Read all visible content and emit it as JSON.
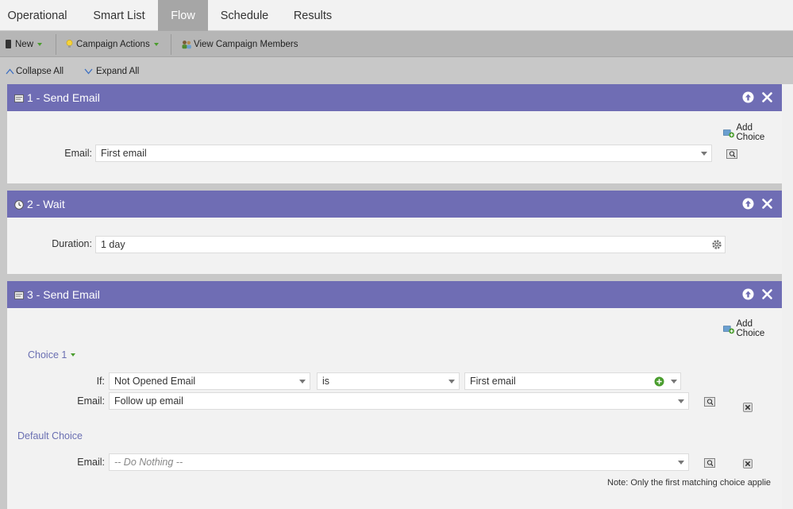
{
  "tabs": [
    {
      "label": "Operational",
      "active": false
    },
    {
      "label": "Smart List",
      "active": false
    },
    {
      "label": "Flow",
      "active": true
    },
    {
      "label": "Schedule",
      "active": false
    },
    {
      "label": "Results",
      "active": false
    }
  ],
  "toolbar": {
    "new_label": "New",
    "campaign_actions_label": "Campaign Actions",
    "view_members_label": "View Campaign Members"
  },
  "subbar": {
    "collapse_label": "Collapse All",
    "expand_label": "Expand All"
  },
  "steps": [
    {
      "title": "1 - Send Email",
      "icon": "email-icon",
      "add_choice": "Add Choice",
      "email_label": "Email:",
      "email_value": "First email"
    },
    {
      "title": "2 - Wait",
      "icon": "clock-icon",
      "duration_label": "Duration:",
      "duration_value": "1 day"
    },
    {
      "title": "3 - Send Email",
      "icon": "email-icon",
      "add_choice": "Add Choice",
      "choice1": {
        "title": "Choice 1",
        "if_label": "If:",
        "condition": "Not Opened Email",
        "operator": "is",
        "value": "First email",
        "email_label": "Email:",
        "email_value": "Follow up email"
      },
      "default_choice": {
        "title": "Default Choice",
        "email_label": "Email:",
        "email_value": "-- Do Nothing --"
      },
      "note": "Note: Only the first matching choice applie"
    }
  ],
  "colors": {
    "step_header": "#6f6db4",
    "tab_active": "#a6a6a6",
    "choice_link": "#6a6fb2",
    "accent_green": "#4a9d2e"
  }
}
